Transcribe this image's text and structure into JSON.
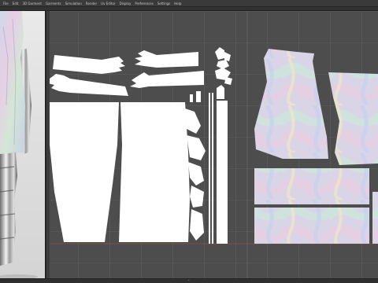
{
  "menubar": {
    "items": [
      "File",
      "Edit",
      "3D Garment",
      "Garments",
      "Simulation",
      "Render",
      "Uv Editor",
      "Display",
      "Preferences",
      "Settings",
      "Help"
    ]
  },
  "window": {
    "title": ""
  },
  "status": {
    "text": ""
  },
  "colors": {
    "uv_bg": "#4d4d4d",
    "island_fill": "#ffffff",
    "texture_base": "#d9d4e6",
    "border_line": "#b74a3c"
  },
  "icons": [
    "chevron-icon"
  ]
}
